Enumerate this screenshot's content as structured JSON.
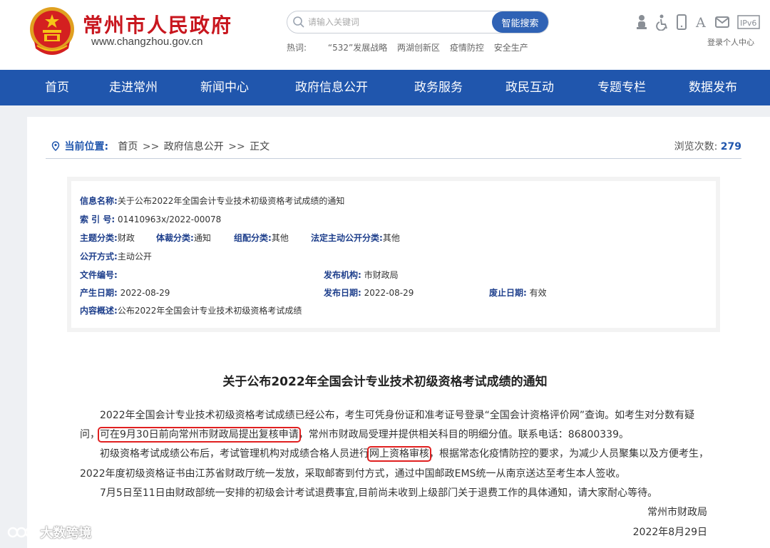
{
  "header": {
    "site_title": "常州市人民政府",
    "site_url": "www.changzhou.gov.cn",
    "search_placeholder": "请输入关键词",
    "search_button": "智能搜索",
    "hot_label": "热词:",
    "hot_words": [
      "“532”发展战略",
      "两湖创新区",
      "疫情防控",
      "安全生产"
    ],
    "tool_icons": [
      "elder-care-icon",
      "accessibility-icon",
      "mobile-icon",
      "font-size-icon",
      "mail-icon",
      "ipv6-badge-icon"
    ],
    "ipv6_text": "IPv6",
    "font_letter": "A",
    "login_text": "登录个人中心",
    "title_color": "#c8161e"
  },
  "nav": {
    "items": [
      "首页",
      "走进常州",
      "新闻中心",
      "政府信息公开",
      "政务服务",
      "政民互动",
      "专题专栏",
      "数据发布"
    ],
    "bg_color": "#2056ad"
  },
  "breadcrumb": {
    "label": "当前位置:",
    "items": [
      "首页",
      "政府信息公开",
      "正文"
    ],
    "sep": ">>",
    "views_label": "浏览次数:",
    "views_count": "279"
  },
  "meta": {
    "info_name_k": "信息名称:",
    "info_name_v": "关于公布2022年全国会计专业技术初级资格考试成绩的通知",
    "index_k": "索 引 号:",
    "index_v": "01410963x/2022-00078",
    "theme_k": "主题分类:",
    "theme_v": "财政",
    "genre_k": "体裁分类:",
    "genre_v": "通知",
    "org_k": "组配分类:",
    "org_v": "其他",
    "legal_k": "法定主动公开分类:",
    "legal_v": "其他",
    "open_k": "公开方式:",
    "open_v": "主动公开",
    "docno_k": "文件编号:",
    "docno_v": "",
    "issuer_k": "发布机构:",
    "issuer_v": "市财政局",
    "created_k": "产生日期:",
    "created_v": "2022-08-29",
    "published_k": "发布日期:",
    "published_v": "2022-08-29",
    "expire_k": "废止日期:",
    "expire_v": "有效",
    "summary_k": "内容概述:",
    "summary_v": "公布2022年全国会计专业技术初级资格考试成绩"
  },
  "article": {
    "title": "关于公布2022年全国会计专业技术初级资格考试成绩的通知",
    "p1_a": "2022年全国会计专业技术初级资格考试成绩已经公布，考生可凭身份证和准考证号登录“全国会计资格评价网”查询。如考生对分数有疑",
    "p1_b_pre": "问，",
    "p1_b_hl": "可在9月30日前向常州市财政局提出复核申请",
    "p1_b_post": "，常州市财政局受理并提供相关科目的明细分值。联系电话：86800339。",
    "p2_a_pre": "初级资格考试成绩公布后，考试管理机构对成绩合格人员进行",
    "p2_a_hl": "网上资格审核",
    "p2_a_post": "，根据常态化疫情防控的要求，为减少人员聚集以及方便考生，",
    "p2_b": "2022年度初级资格证书由江苏省财政厅统一发放，采取邮寄到付方式，通过中国邮政EMS统一从南京送达至考生本人签收。",
    "p3": "7月5日至11日由财政部统一安排的初级会计考试退费事宜,目前尚未收到上级部门关于退费工作的具体通知，请大家耐心等待。",
    "signer": "常州市财政局",
    "date": "2022年8月29日"
  },
  "watermark": "大数跨境",
  "colors": {
    "highlight": "#e02020",
    "link_blue": "#2056ad"
  }
}
